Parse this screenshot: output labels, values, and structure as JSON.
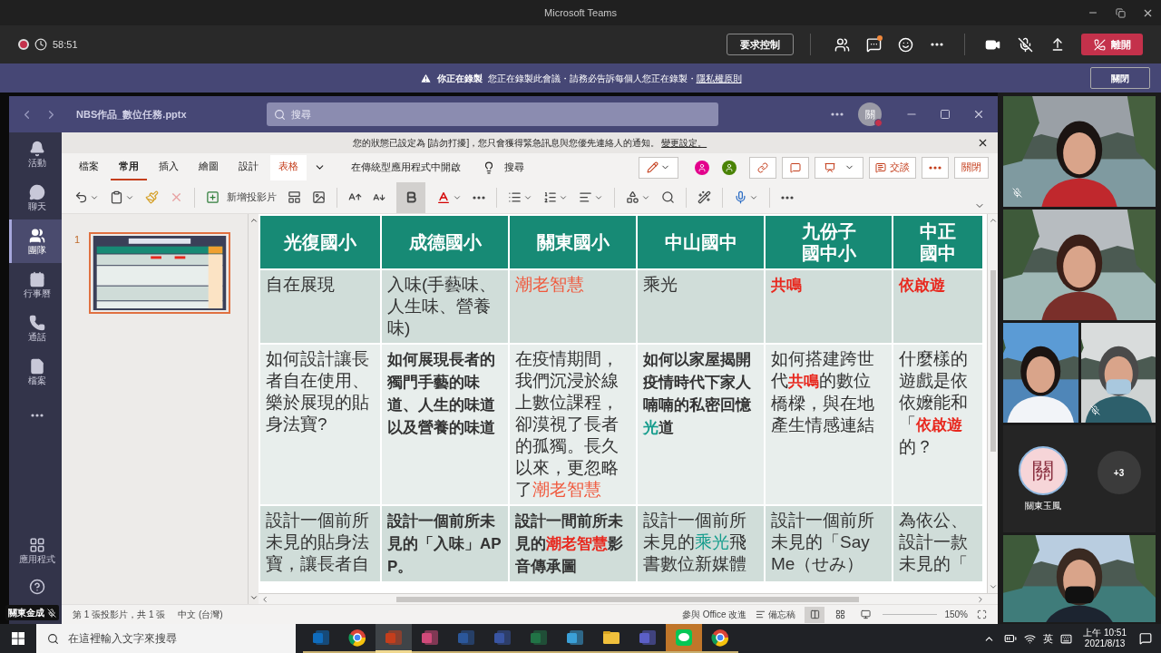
{
  "window": {
    "title": "Microsoft Teams"
  },
  "meeting": {
    "recording": true,
    "duration": "58:51",
    "request_control": "要求控制",
    "chat_unread": true,
    "mic_muted": true,
    "leave": "離開"
  },
  "banner": {
    "title": "你正在錄製",
    "message": "您正在錄製此會議・請務必告訴每個人您正在錄製・",
    "link": "隱私權原則",
    "dismiss": "關閉"
  },
  "teams_header": {
    "file_name": "NBS作品_數位任務.pptx",
    "search_placeholder": "搜尋",
    "avatar": "關"
  },
  "rail": [
    {
      "kind": "bell",
      "label": "活動",
      "selected": false
    },
    {
      "kind": "chat",
      "label": "聊天",
      "selected": false
    },
    {
      "kind": "teams",
      "label": "團隊",
      "selected": true
    },
    {
      "kind": "calendar",
      "label": "行事曆",
      "selected": false
    },
    {
      "kind": "calls",
      "label": "通話",
      "selected": false
    },
    {
      "kind": "files",
      "label": "檔案",
      "selected": false
    },
    {
      "kind": "more",
      "selected": false
    }
  ],
  "rail_bottom": [
    {
      "kind": "apps",
      "label": "應用程式"
    },
    {
      "kind": "help"
    }
  ],
  "presenter": {
    "name": "關東金成",
    "muted": true
  },
  "notice": {
    "text": "您的狀態已設定為 [請勿打擾]，您只會獲得緊急訊息與您優先連絡人的通知。",
    "link": "變更設定。"
  },
  "ribbon_tabs": [
    {
      "label": "檔案",
      "selected": false,
      "highlighted": false
    },
    {
      "label": "常用",
      "selected": true,
      "highlighted": false
    },
    {
      "label": "插入",
      "selected": false,
      "highlighted": false
    },
    {
      "label": "繪圖",
      "selected": false,
      "highlighted": false
    },
    {
      "label": "設計",
      "selected": false,
      "highlighted": false
    },
    {
      "label": "表格",
      "selected": false,
      "highlighted": true
    }
  ],
  "open_desktop": "在傳統型應用程式中開啟",
  "tell_me": "搜尋",
  "collaborators": [
    {
      "color": "#e3008c"
    },
    {
      "color": "#498205"
    }
  ],
  "conversation": "交談",
  "close": "關閉",
  "toolbar": {
    "new_slide": "新增投影片",
    "bold_active": true
  },
  "slides": [
    {
      "number": "1",
      "selected": true
    }
  ],
  "table": {
    "columns": [
      "光復國小",
      "成德國小",
      "關東國小",
      "中山國中",
      "九份子國中小",
      "中正國中"
    ],
    "rows": [
      [
        [
          {
            "text": "自在展現"
          }
        ],
        [
          {
            "text": "入味(手藝味、人生味、營養味)"
          }
        ],
        [
          {
            "text": "潮老智慧",
            "color": "#f0583c"
          }
        ],
        [
          {
            "text": "乘光"
          }
        ],
        [
          {
            "text": "共鳴",
            "color": "#e8281e",
            "bold": true
          }
        ],
        [
          {
            "text": "依啟遊",
            "color": "#e8281e",
            "bold": true
          }
        ]
      ],
      [
        [
          {
            "text": "如何設計讓長者自在使用、樂於展現的貼身法寶?"
          }
        ],
        [
          {
            "text": "如何展現長者的獨門手藝的味道、人生的味道以及營養的味道",
            "bold": true
          }
        ],
        [
          {
            "text": "在疫情期間，我們沉浸於線上數位課程，卻漠視了長者的孤獨。長久以來，更忽略了"
          },
          {
            "text": "潮老智慧",
            "color": "#f0583c"
          }
        ],
        [
          {
            "text": "如何以家屋揭開疫情時代下家人喃喃的私密回憶",
            "bold": true
          },
          {
            "text": "光",
            "color": "#149c8c",
            "bold": true
          },
          {
            "text": "道",
            "bold": true
          }
        ],
        [
          {
            "text": "如何搭建跨世代"
          },
          {
            "text": "共鳴",
            "color": "#e8281e",
            "bold": true
          },
          {
            "text": "的數位橋樑，與在地產生情感連結"
          }
        ],
        [
          {
            "text": "什麼樣的遊戲是依依嬤能和「"
          },
          {
            "text": "依啟遊",
            "color": "#e8281e",
            "bold": true
          },
          {
            "text": "的？"
          }
        ]
      ],
      [
        [
          {
            "text": "設計一個前所未見的貼身法寶，讓長者自"
          }
        ],
        [
          {
            "text": "設計一個前所未見的「入味」APP。",
            "bold": true
          }
        ],
        [
          {
            "text": "設計一間前所未見的",
            "bold": true
          },
          {
            "text": "潮老智慧",
            "color": "#e8281e",
            "bold": true
          },
          {
            "text": "影音傳承圖",
            "bold": true
          }
        ],
        [
          {
            "text": "設計一個前所未見的"
          },
          {
            "text": "乘光",
            "color": "#149c8c"
          },
          {
            "text": "飛書數位新媒體"
          }
        ],
        [
          {
            "text": "設計一個前所未見的「Say Me（せみ）"
          }
        ],
        [
          {
            "text": "為依公、設計一款未見的「"
          }
        ]
      ]
    ]
  },
  "status_bar": {
    "slide_info": "第 1 張投影片，共 1 張",
    "language": "中文 (台灣)",
    "feedback": "參與 Office 改進",
    "notes": "備忘稿",
    "zoom": "150%"
  },
  "participants": {
    "tiles": [
      {
        "muted": true
      },
      {
        "muted": false
      }
    ],
    "pair": [
      {
        "muted": false
      },
      {
        "muted": true
      }
    ],
    "avatar": {
      "initial": "關",
      "name": "關東玉鳳"
    },
    "overflow": "+3",
    "last_tile": {
      "muted": false
    }
  },
  "taskbar": {
    "search_placeholder": "在這裡輸入文字來搜尋",
    "apps": [
      {
        "kind": "mail",
        "selected": false,
        "attention": false
      },
      {
        "kind": "browser",
        "selected": false,
        "attention": false
      },
      {
        "kind": "slides",
        "selected": true,
        "attention": false
      },
      {
        "kind": "paint",
        "selected": false,
        "attention": false
      },
      {
        "kind": "word",
        "selected": false,
        "attention": false
      },
      {
        "kind": "diagram",
        "selected": false,
        "attention": false
      },
      {
        "kind": "sheet",
        "selected": false,
        "attention": false
      },
      {
        "kind": "remote",
        "selected": false,
        "attention": false
      },
      {
        "kind": "folder",
        "selected": false,
        "attention": false
      },
      {
        "kind": "teams",
        "selected": false,
        "attention": false
      },
      {
        "kind": "line",
        "selected": false,
        "attention": true
      },
      {
        "kind": "browser",
        "selected": false,
        "attention": false
      }
    ],
    "ime": "英",
    "time": "上午 10:51",
    "date": "2021/8/13"
  }
}
